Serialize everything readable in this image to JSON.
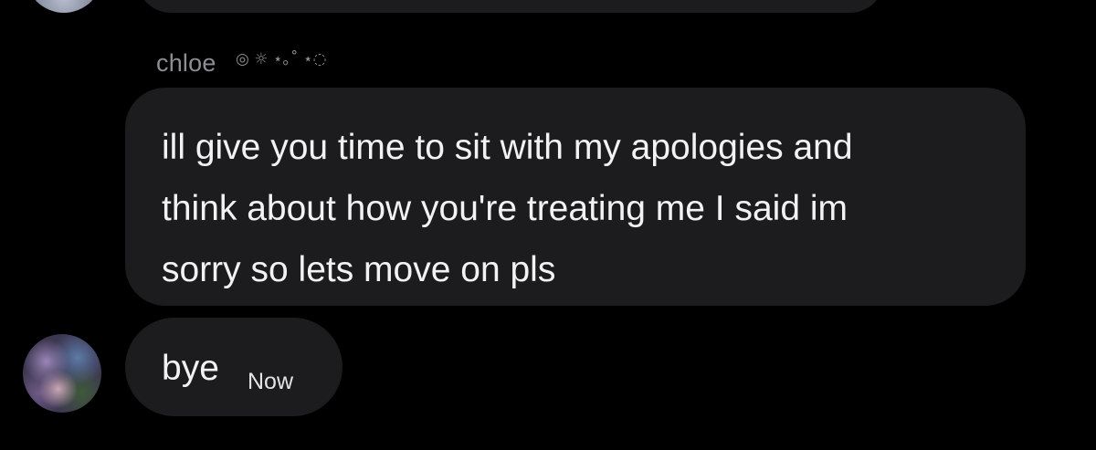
{
  "thread": {
    "sender": {
      "name": "chloe",
      "name_decoration": "◎ ☼ ⋆｡˚ ⋆◌"
    },
    "messages": [
      {
        "text": "ill give you time to sit with my apologies and\nthink about how you're treating me I said im\nsorry so lets move on pls"
      },
      {
        "text": "bye",
        "time": "Now"
      }
    ]
  },
  "colors": {
    "background": "#000000",
    "bubble": "#1c1c1e",
    "name_text": "#8d8d93",
    "message_text": "#f2f2f4"
  },
  "icons": {
    "top_avatar": "avatar-partial",
    "main_avatar": "avatar"
  }
}
